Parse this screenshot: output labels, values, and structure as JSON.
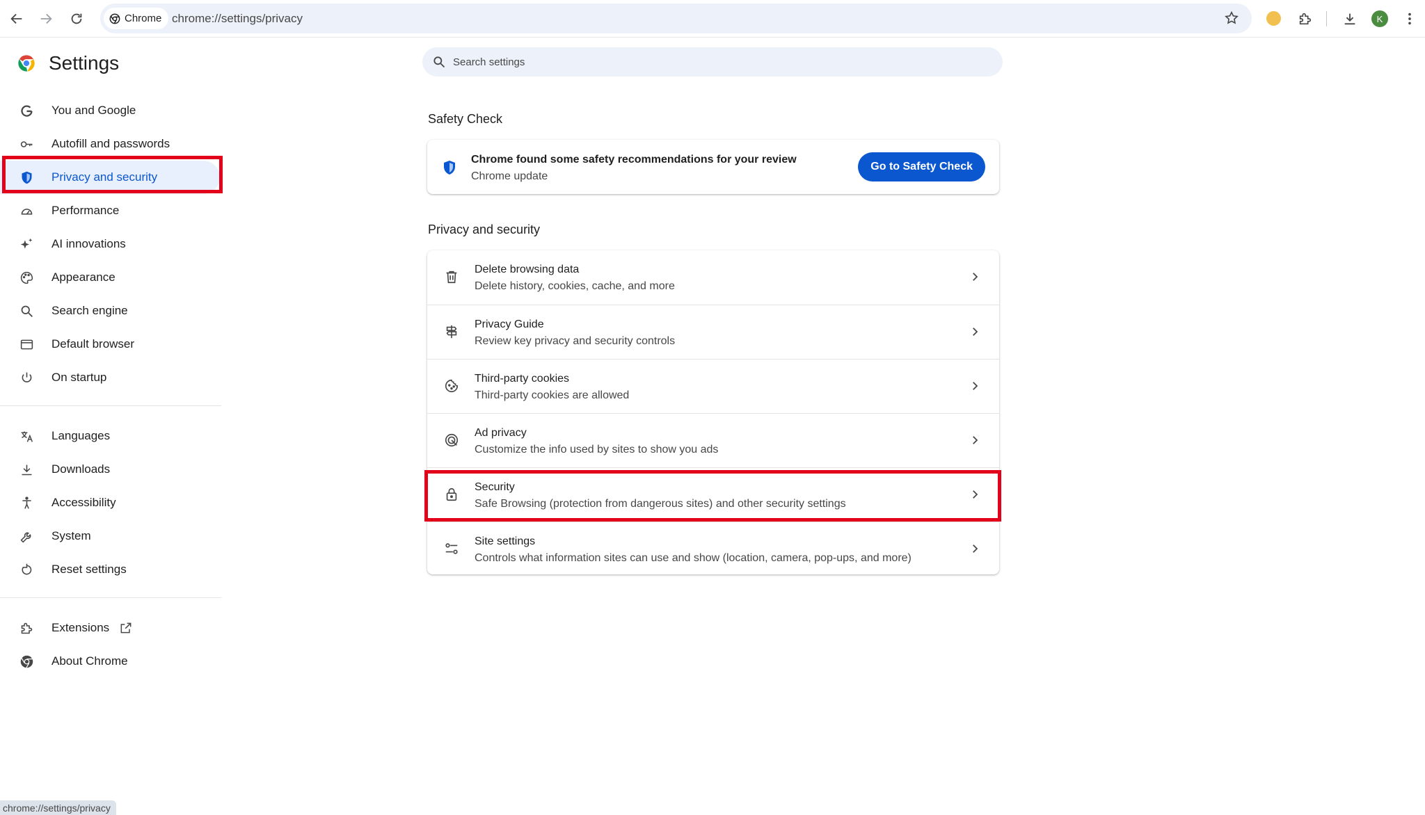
{
  "toolbar": {
    "chip_label": "Chrome",
    "url": "chrome://settings/privacy",
    "avatar_letter": "K"
  },
  "sidebar": {
    "title": "Settings",
    "groups": [
      [
        {
          "label": "You and Google",
          "icon": "google-g-icon"
        },
        {
          "label": "Autofill and passwords",
          "icon": "key-icon"
        },
        {
          "label": "Privacy and security",
          "icon": "shield-icon",
          "active": true
        },
        {
          "label": "Performance",
          "icon": "gauge-icon"
        },
        {
          "label": "AI innovations",
          "icon": "sparkle-icon"
        },
        {
          "label": "Appearance",
          "icon": "palette-icon"
        },
        {
          "label": "Search engine",
          "icon": "search-icon"
        },
        {
          "label": "Default browser",
          "icon": "browser-window-icon"
        },
        {
          "label": "On startup",
          "icon": "power-icon"
        }
      ],
      [
        {
          "label": "Languages",
          "icon": "translate-icon"
        },
        {
          "label": "Downloads",
          "icon": "download-icon"
        },
        {
          "label": "Accessibility",
          "icon": "accessibility-icon"
        },
        {
          "label": "System",
          "icon": "wrench-icon"
        },
        {
          "label": "Reset settings",
          "icon": "reset-icon"
        }
      ],
      [
        {
          "label": "Extensions",
          "icon": "puzzle-icon"
        },
        {
          "label": "About Chrome",
          "icon": "chrome-icon"
        }
      ]
    ]
  },
  "search": {
    "placeholder": "Search settings"
  },
  "safety_check": {
    "heading": "Safety Check",
    "title": "Chrome found some safety recommendations for your review",
    "subtitle": "Chrome update",
    "button": "Go to Safety Check"
  },
  "privacy": {
    "heading": "Privacy and security",
    "rows": [
      {
        "title": "Delete browsing data",
        "subtitle": "Delete history, cookies, cache, and more",
        "icon": "trash-icon"
      },
      {
        "title": "Privacy Guide",
        "subtitle": "Review key privacy and security controls",
        "icon": "signpost-icon"
      },
      {
        "title": "Third-party cookies",
        "subtitle": "Third-party cookies are allowed",
        "icon": "cookie-icon"
      },
      {
        "title": "Ad privacy",
        "subtitle": "Customize the info used by sites to show you ads",
        "icon": "ad-privacy-icon"
      },
      {
        "title": "Security",
        "subtitle": "Safe Browsing (protection from dangerous sites) and other security settings",
        "icon": "lock-icon"
      },
      {
        "title": "Site settings",
        "subtitle": "Controls what information sites can use and show (location, camera, pop-ups, and more)",
        "icon": "tune-icon"
      }
    ]
  },
  "status_bar": {
    "text": "chrome://settings/privacy"
  },
  "colors": {
    "accent": "#0b57d0",
    "highlight": "#e3001b",
    "omnibox": "#edf2fa"
  }
}
